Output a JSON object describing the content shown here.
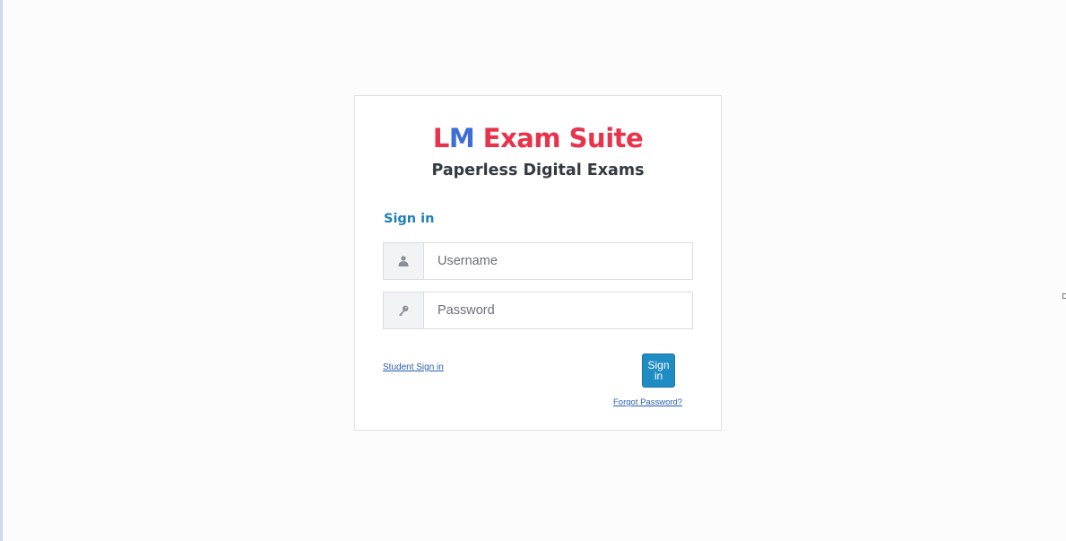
{
  "brand": {
    "lm_l": "L",
    "lm_m": "M",
    "suite": " Exam Suite",
    "tagline": "Paperless Digital Exams"
  },
  "form": {
    "heading": "Sign in",
    "username": {
      "placeholder": "Username",
      "value": "",
      "icon": "user-icon"
    },
    "password": {
      "placeholder": "Password",
      "value": "",
      "icon": "key-icon"
    },
    "submit_label": "Sign in"
  },
  "links": {
    "student_sign_in": "Student Sign in",
    "forgot_password": "Forgot Password?"
  },
  "colors": {
    "brand_red": "#e8334b",
    "brand_blue": "#3d6fd6",
    "accent": "#1f8cc3",
    "heading": "#1f7fb8"
  }
}
